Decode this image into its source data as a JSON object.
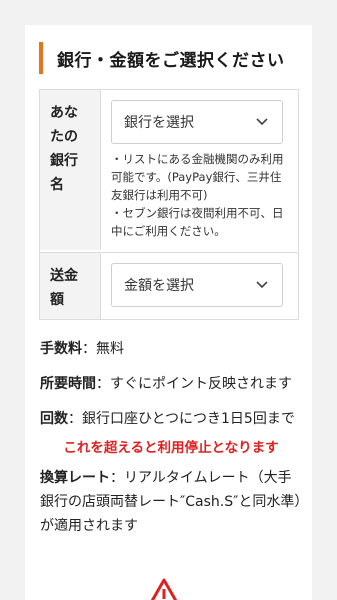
{
  "heading": "銀行・金額をご選択ください",
  "bank_row": {
    "label": "あなたの銀行名",
    "select_placeholder": "銀行を選択",
    "note": "・リストにある金融機関のみ利用可能です。(PayPay銀行、三井住友銀行は利用不可)\n・セブン銀行は夜間利用不可、日中にご利用ください。"
  },
  "amount_row": {
    "label": "送金額",
    "select_placeholder": "金額を選択"
  },
  "info": {
    "fee_label": "手数料",
    "fee_value": "：無料",
    "time_label": "所要時間",
    "time_value": "：すぐにポイント反映されます",
    "count_label": "回数",
    "count_value": "：銀行口座ひとつにつき1日5回まで",
    "warning": "これを超えると利用停止となります",
    "rate_label": "換算レート",
    "rate_value": "：リアルタイムレート（大手銀行の店頭両替レート″Cash.S″と同水準）が適用されます"
  },
  "colors": {
    "accent": "#e8731f",
    "warning": "#e02020"
  },
  "icons": {
    "select_chevron": "chevron-down-icon",
    "alert": "warning-triangle-icon"
  }
}
